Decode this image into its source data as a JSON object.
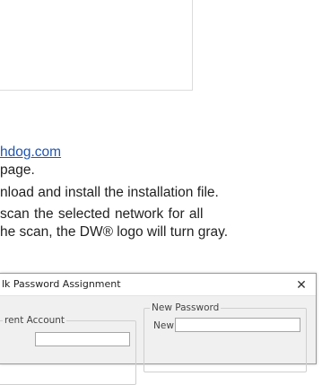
{
  "doc": {
    "link_text": "hdog.com",
    "line2": "page.",
    "line3": "nload and install the installation file.",
    "line4": " scan  the  selected  network  for  all",
    "line5": "he scan, the DW® logo will turn gray."
  },
  "dialog": {
    "title": "lk Password Assignment",
    "close_glyph": "✕",
    "current_account_label": "rent Account",
    "new_password_label": "New Password",
    "new_field_label": "New"
  }
}
